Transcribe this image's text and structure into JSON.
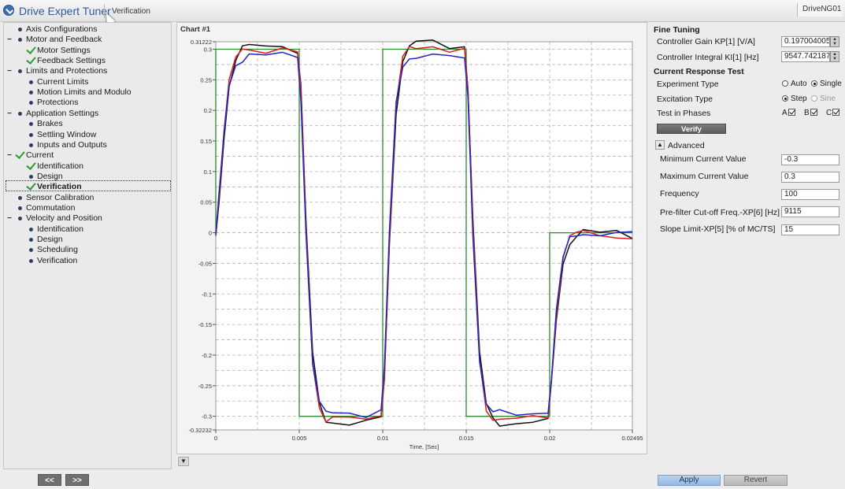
{
  "app": {
    "title": "Drive Expert Tuner",
    "page": "Verification",
    "device": "DriveNG01"
  },
  "sidebar": {
    "items": [
      {
        "label": "Axis Configurations",
        "level": 1,
        "marker": "bullet",
        "expander": ""
      },
      {
        "label": "Motor and Feedback",
        "level": 1,
        "marker": "bullet",
        "expander": "minus"
      },
      {
        "label": "Motor Settings",
        "level": 2,
        "marker": "check"
      },
      {
        "label": "Feedback Settings",
        "level": 2,
        "marker": "check"
      },
      {
        "label": "Limits and Protections",
        "level": 1,
        "marker": "bullet",
        "expander": "minus"
      },
      {
        "label": "Current Limits",
        "level": 2,
        "marker": "bullet"
      },
      {
        "label": "Motion Limits and Modulo",
        "level": 2,
        "marker": "bullet"
      },
      {
        "label": "Protections",
        "level": 2,
        "marker": "bullet"
      },
      {
        "label": "Application Settings",
        "level": 1,
        "marker": "bullet",
        "expander": "minus"
      },
      {
        "label": "Brakes",
        "level": 2,
        "marker": "bullet"
      },
      {
        "label": "Settling Window",
        "level": 2,
        "marker": "bullet"
      },
      {
        "label": "Inputs and Outputs",
        "level": 2,
        "marker": "bullet"
      },
      {
        "label": "Current",
        "level": 1,
        "marker": "check",
        "expander": "minus"
      },
      {
        "label": "Identification",
        "level": 2,
        "marker": "check"
      },
      {
        "label": "Design",
        "level": 2,
        "marker": "bullet"
      },
      {
        "label": "Verification",
        "level": 2,
        "marker": "check",
        "selected": true
      },
      {
        "label": "Sensor Calibration",
        "level": 1,
        "marker": "bullet",
        "expander": ""
      },
      {
        "label": "Commutation",
        "level": 1,
        "marker": "bullet",
        "expander": ""
      },
      {
        "label": "Velocity and Position",
        "level": 1,
        "marker": "bullet",
        "expander": "minus"
      },
      {
        "label": "Identification",
        "level": 2,
        "marker": "bullet"
      },
      {
        "label": "Design",
        "level": 2,
        "marker": "bullet"
      },
      {
        "label": "Scheduling",
        "level": 2,
        "marker": "bullet"
      },
      {
        "label": "Verification",
        "level": 2,
        "marker": "bullet"
      }
    ],
    "prev_label": "<<",
    "next_label": ">>"
  },
  "chart": {
    "title": "Chart #1",
    "collapse_icon": "chevron-down-icon"
  },
  "chart_data": {
    "type": "line",
    "title": "",
    "xlabel": "Time, [Sec]",
    "ylabel": "",
    "xlim": [
      0,
      0.02495
    ],
    "ylim": [
      -0.32232,
      0.31222
    ],
    "x_ticks": [
      "0",
      "0.005",
      "0.01",
      "0.015",
      "0.02",
      "0.02495"
    ],
    "x_tick_values": [
      0,
      0.005,
      0.01,
      0.015,
      0.02,
      0.02495
    ],
    "y_ticks": [
      "0.31222",
      "0.3",
      "0.25",
      "0.2",
      "0.15",
      "0.1",
      "0.05",
      "0",
      "-0.05",
      "-0.1",
      "-0.15",
      "-0.2",
      "-0.25",
      "-0.3",
      "-0.32232"
    ],
    "y_tick_values": [
      0.31222,
      0.3,
      0.25,
      0.2,
      0.15,
      0.1,
      0.05,
      0,
      -0.05,
      -0.1,
      -0.15,
      -0.2,
      -0.25,
      -0.3,
      -0.32232
    ],
    "grid": true,
    "series": [
      {
        "color": "#2d8a2d",
        "x": [
          0,
          0,
          0.005,
          0.005,
          0.01,
          0.01,
          0.015,
          0.015,
          0.02,
          0.02,
          0.02495
        ],
        "values": [
          0,
          0.3,
          0.3,
          -0.3,
          -0.3,
          0.3,
          0.3,
          -0.3,
          -0.3,
          0,
          0
        ]
      },
      {
        "color": "#111111",
        "x": [
          0,
          0.0002,
          0.0005,
          0.0008,
          0.0012,
          0.0016,
          0.002,
          0.003,
          0.004,
          0.0049,
          0.0051,
          0.0054,
          0.0058,
          0.0062,
          0.0066,
          0.007,
          0.008,
          0.009,
          0.0099,
          0.0101,
          0.0104,
          0.0108,
          0.0112,
          0.0116,
          0.012,
          0.013,
          0.014,
          0.0149,
          0.0151,
          0.0154,
          0.0158,
          0.0162,
          0.0166,
          0.017,
          0.018,
          0.019,
          0.0199,
          0.0201,
          0.0204,
          0.0208,
          0.0212,
          0.0216,
          0.022,
          0.023,
          0.024,
          0.02495
        ],
        "values": [
          -0.01,
          0.05,
          0.16,
          0.24,
          0.285,
          0.3,
          0.305,
          0.305,
          0.305,
          0.3,
          0.24,
          0.02,
          -0.2,
          -0.28,
          -0.305,
          -0.31,
          -0.31,
          -0.31,
          -0.305,
          -0.24,
          -0.02,
          0.2,
          0.28,
          0.305,
          0.31,
          0.31,
          0.305,
          0.305,
          0.24,
          0.02,
          -0.2,
          -0.28,
          -0.305,
          -0.31,
          -0.31,
          -0.31,
          -0.305,
          -0.25,
          -0.14,
          -0.05,
          -0.015,
          -0.005,
          0,
          0,
          0,
          -0.005
        ]
      },
      {
        "color": "#d62020",
        "x": [
          0,
          0.0002,
          0.0005,
          0.0008,
          0.0012,
          0.0016,
          0.002,
          0.003,
          0.004,
          0.0049,
          0.0051,
          0.0054,
          0.0058,
          0.0062,
          0.0066,
          0.007,
          0.008,
          0.009,
          0.0099,
          0.0101,
          0.0104,
          0.0108,
          0.0112,
          0.0116,
          0.012,
          0.013,
          0.014,
          0.0149,
          0.0151,
          0.0154,
          0.0158,
          0.0162,
          0.0166,
          0.017,
          0.018,
          0.019,
          0.0199,
          0.0201,
          0.0204,
          0.0208,
          0.0212,
          0.0216,
          0.022,
          0.023,
          0.024,
          0.02495
        ],
        "values": [
          0,
          0.06,
          0.17,
          0.245,
          0.285,
          0.3,
          0.3,
          0.3,
          0.3,
          0.295,
          0.23,
          0.01,
          -0.21,
          -0.285,
          -0.305,
          -0.305,
          -0.305,
          -0.305,
          -0.3,
          -0.23,
          -0.01,
          0.21,
          0.285,
          0.3,
          0.305,
          0.305,
          0.3,
          0.3,
          0.23,
          0.01,
          -0.21,
          -0.285,
          -0.305,
          -0.305,
          -0.305,
          -0.305,
          -0.3,
          -0.24,
          -0.13,
          -0.04,
          -0.01,
          0,
          0,
          0,
          -0.005,
          -0.01
        ]
      },
      {
        "color": "#2424c8",
        "x": [
          0,
          0.0002,
          0.0005,
          0.0008,
          0.0012,
          0.0016,
          0.002,
          0.003,
          0.004,
          0.0049,
          0.0051,
          0.0054,
          0.0058,
          0.0062,
          0.0066,
          0.007,
          0.008,
          0.009,
          0.0099,
          0.0101,
          0.0104,
          0.0108,
          0.0112,
          0.0116,
          0.012,
          0.013,
          0.014,
          0.0149,
          0.0151,
          0.0154,
          0.0158,
          0.0162,
          0.0166,
          0.017,
          0.018,
          0.019,
          0.0199,
          0.0201,
          0.0204,
          0.0208,
          0.0212,
          0.0216,
          0.022,
          0.023,
          0.024,
          0.02495
        ],
        "values": [
          0,
          0.06,
          0.165,
          0.24,
          0.275,
          0.285,
          0.29,
          0.29,
          0.29,
          0.285,
          0.22,
          0.0,
          -0.21,
          -0.28,
          -0.295,
          -0.295,
          -0.295,
          -0.295,
          -0.29,
          -0.22,
          0.0,
          0.21,
          0.275,
          0.285,
          0.29,
          0.29,
          0.285,
          0.285,
          0.22,
          0.0,
          -0.21,
          -0.28,
          -0.295,
          -0.295,
          -0.295,
          -0.295,
          -0.29,
          -0.24,
          -0.13,
          -0.04,
          -0.01,
          0,
          0,
          -0.005,
          0,
          -0.005
        ]
      }
    ]
  },
  "fine_tuning": {
    "header": "Fine Tuning",
    "kp_label": "Controller Gain KP[1] [V/A]",
    "kp_value": "0.1970040053",
    "ki_label": "Controller Integral KI[1] [Hz]",
    "ki_value": "9547.7421875"
  },
  "response_test": {
    "header": "Current Response Test",
    "experiment_label": "Experiment Type",
    "exp_auto": "Auto",
    "exp_single": "Single",
    "excitation_label": "Excitation Type",
    "exc_step": "Step",
    "exc_sine": "Sine",
    "phases_label": "Test in Phases",
    "phase_a": "A",
    "phase_b": "B",
    "phase_c": "C",
    "verify_label": "Verify"
  },
  "advanced": {
    "label": "Advanced",
    "min_label": "Minimum Current Value",
    "min_value": "-0.3",
    "max_label": "Maximum Current Value",
    "max_value": "0.3",
    "freq_label": "Frequency",
    "freq_value": "100",
    "prefilter_label": "Pre-filter Cut-off Freq.-XP[6] [Hz]",
    "prefilter_value": "9115",
    "slope_label": "Slope Limit-XP[5] [% of MC/TS]",
    "slope_value": "15"
  },
  "footer": {
    "apply_label": "Apply",
    "revert_label": "Revert"
  }
}
